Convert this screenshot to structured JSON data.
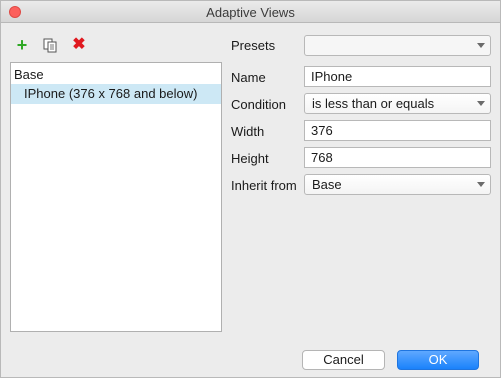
{
  "window": {
    "title": "Adaptive Views"
  },
  "toolbar": {
    "add_icon": "plus-icon",
    "copy_icon": "copy-icon",
    "delete_icon": "x-icon"
  },
  "tree": {
    "root": "Base",
    "children": [
      "IPhone (376 x 768 and below)"
    ]
  },
  "form": {
    "presets_label": "Presets",
    "presets_value": "",
    "name_label": "Name",
    "name_value": "IPhone",
    "condition_label": "Condition",
    "condition_value": "is less than or equals",
    "width_label": "Width",
    "width_value": "376",
    "height_label": "Height",
    "height_value": "768",
    "inherit_label": "Inherit from",
    "inherit_value": "Base"
  },
  "buttons": {
    "cancel": "Cancel",
    "ok": "OK"
  },
  "colors": {
    "selection": "#cde8f5",
    "primary_button": "#1a82fb",
    "add": "#2fa825",
    "delete": "#e0191f"
  }
}
